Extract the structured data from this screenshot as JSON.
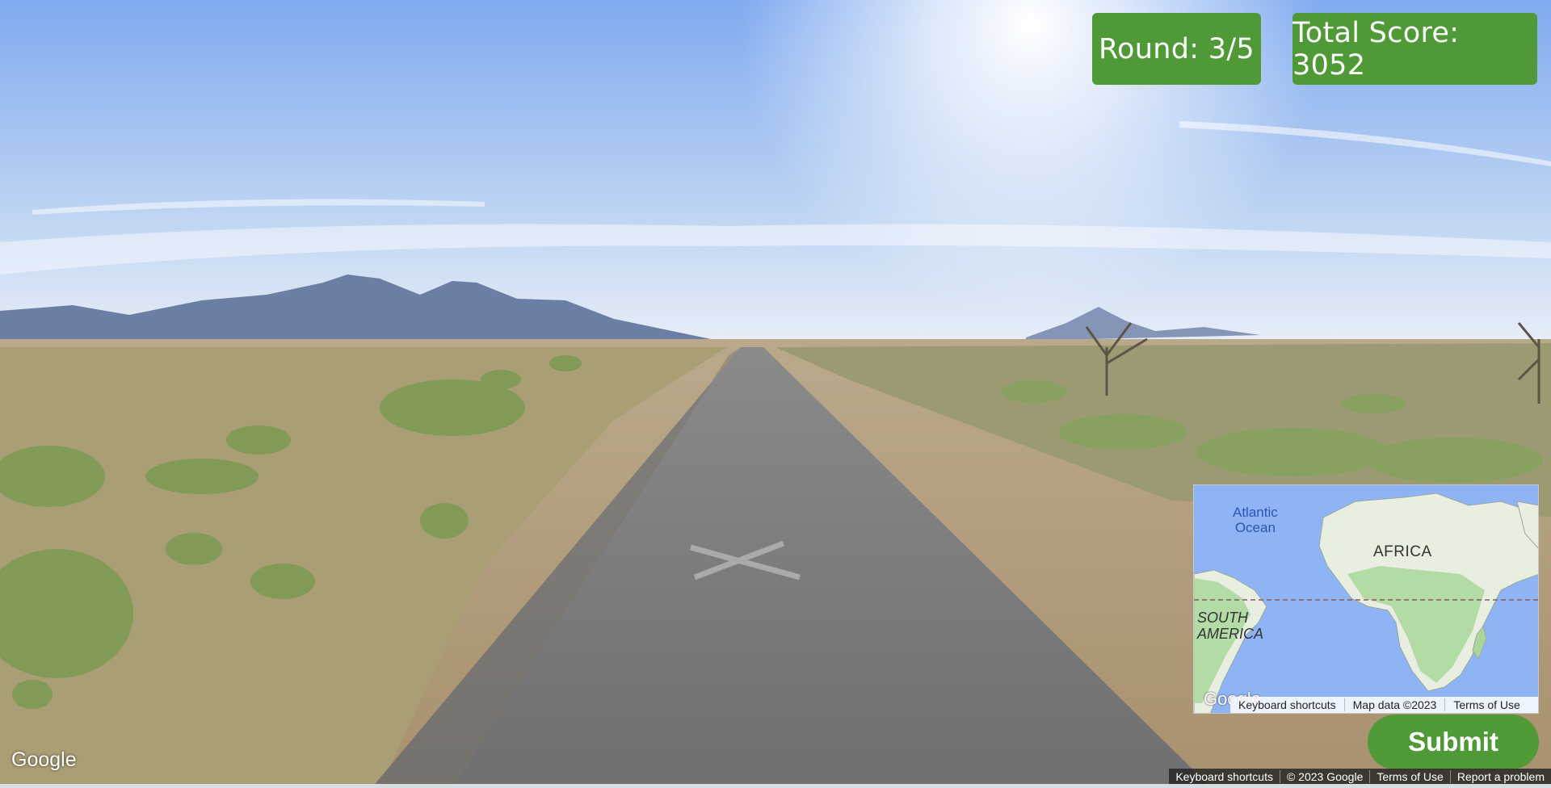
{
  "hud": {
    "round_label": "Round: 3/5",
    "score_label": "Total Score: 3052"
  },
  "minimap": {
    "labels": {
      "atlantic": "Atlantic\nOcean",
      "africa": "AFRICA",
      "south_america": "SOUTH\nAMERICA"
    },
    "logo": "Google",
    "footer": [
      "Keyboard shortcuts",
      "Map data ©2023",
      "Terms of Use"
    ]
  },
  "submit": {
    "label": "Submit"
  },
  "streetview": {
    "logo": "Google",
    "footer": [
      "Keyboard shortcuts",
      "© 2023 Google",
      "Terms of Use",
      "Report a problem"
    ]
  },
  "colors": {
    "hud_green": "#4f9a36",
    "ocean": "#8fb4f5",
    "land": "#e8efe0",
    "land_green": "#a9d79a"
  }
}
